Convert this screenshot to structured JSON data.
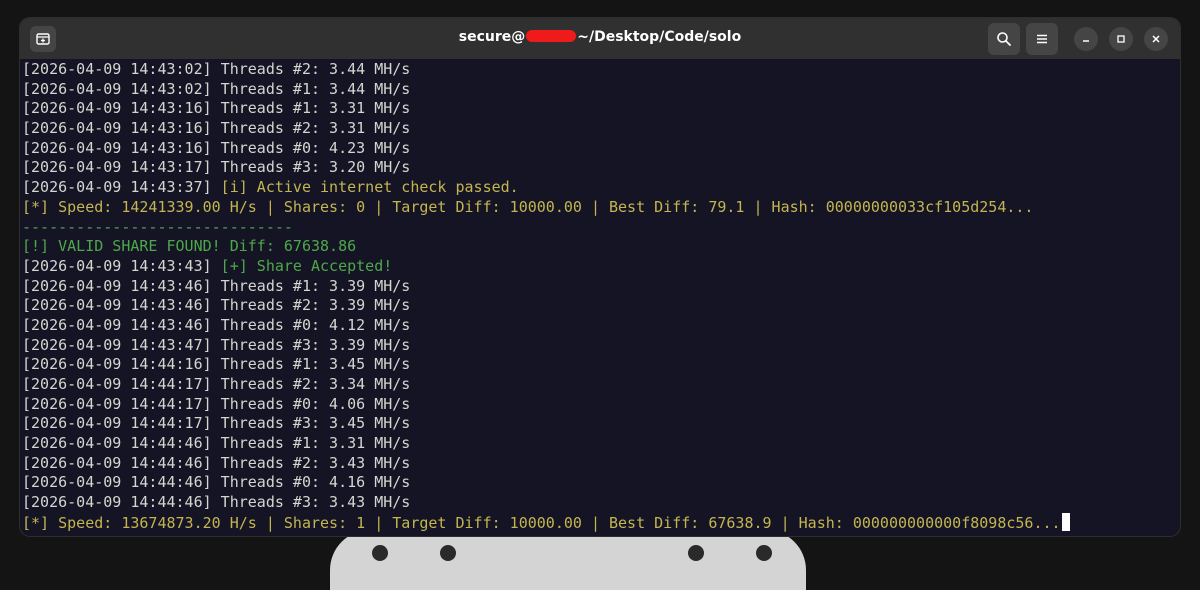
{
  "window": {
    "title_prefix": "secure@",
    "title_suffix": "~/Desktop/Code/solo"
  },
  "icons": {
    "new_tab": "new-tab-icon",
    "search": "search-icon",
    "menu": "hamburger-menu-icon",
    "minimize": "minimize-icon",
    "maximize": "maximize-icon",
    "close": "close-icon"
  },
  "colors": {
    "terminal_bg": "#141425",
    "text": "#d3d7cf",
    "status_yellow": "#c4b550",
    "success_green": "#4ea84a",
    "redaction": "#ef1b1b"
  },
  "lines": [
    {
      "ts": "[2026-04-09 14:43:02]",
      "msg": " Threads #2: 3.44 MH/s",
      "style": "normal"
    },
    {
      "ts": "[2026-04-09 14:43:02]",
      "msg": " Threads #1: 3.44 MH/s",
      "style": "normal"
    },
    {
      "ts": "[2026-04-09 14:43:16]",
      "msg": " Threads #1: 3.31 MH/s",
      "style": "normal"
    },
    {
      "ts": "[2026-04-09 14:43:16]",
      "msg": " Threads #2: 3.31 MH/s",
      "style": "normal"
    },
    {
      "ts": "[2026-04-09 14:43:16]",
      "msg": " Threads #0: 4.23 MH/s",
      "style": "normal"
    },
    {
      "ts": "[2026-04-09 14:43:17]",
      "msg": " Threads #3: 3.20 MH/s",
      "style": "normal"
    },
    {
      "ts": "[2026-04-09 14:43:37]",
      "msg": " [i] Active internet check passed.",
      "style": "ts-yellow"
    },
    {
      "ts": "",
      "msg": "[*] Speed: 14241339.00 H/s | Shares: 0 | Target Diff: 10000.00 | Best Diff: 79.1 | Hash: 00000000033cf105d254...",
      "style": "yellow"
    },
    {
      "ts": "",
      "msg": "------------------------------",
      "style": "green"
    },
    {
      "ts": "",
      "msg": "[!] VALID SHARE FOUND! Diff: 67638.86",
      "style": "green"
    },
    {
      "ts": "[2026-04-09 14:43:43]",
      "msg": " [+] Share Accepted!",
      "style": "ts-green"
    },
    {
      "ts": "[2026-04-09 14:43:46]",
      "msg": " Threads #1: 3.39 MH/s",
      "style": "normal"
    },
    {
      "ts": "[2026-04-09 14:43:46]",
      "msg": " Threads #2: 3.39 MH/s",
      "style": "normal"
    },
    {
      "ts": "[2026-04-09 14:43:46]",
      "msg": " Threads #0: 4.12 MH/s",
      "style": "normal"
    },
    {
      "ts": "[2026-04-09 14:43:47]",
      "msg": " Threads #3: 3.39 MH/s",
      "style": "normal"
    },
    {
      "ts": "[2026-04-09 14:44:16]",
      "msg": " Threads #1: 3.45 MH/s",
      "style": "normal"
    },
    {
      "ts": "[2026-04-09 14:44:17]",
      "msg": " Threads #2: 3.34 MH/s",
      "style": "normal"
    },
    {
      "ts": "[2026-04-09 14:44:17]",
      "msg": " Threads #0: 4.06 MH/s",
      "style": "normal"
    },
    {
      "ts": "[2026-04-09 14:44:17]",
      "msg": " Threads #3: 3.45 MH/s",
      "style": "normal"
    },
    {
      "ts": "[2026-04-09 14:44:46]",
      "msg": " Threads #1: 3.31 MH/s",
      "style": "normal"
    },
    {
      "ts": "[2026-04-09 14:44:46]",
      "msg": " Threads #2: 3.43 MH/s",
      "style": "normal"
    },
    {
      "ts": "[2026-04-09 14:44:46]",
      "msg": " Threads #0: 4.16 MH/s",
      "style": "normal"
    },
    {
      "ts": "[2026-04-09 14:44:46]",
      "msg": " Threads #3: 3.43 MH/s",
      "style": "normal"
    },
    {
      "ts": "",
      "msg": "[*] Speed: 13674873.20 H/s | Shares: 1 | Target Diff: 10000.00 | Best Diff: 67638.9 | Hash: 000000000000f8098c56...",
      "style": "yellow",
      "cursor": true
    }
  ]
}
